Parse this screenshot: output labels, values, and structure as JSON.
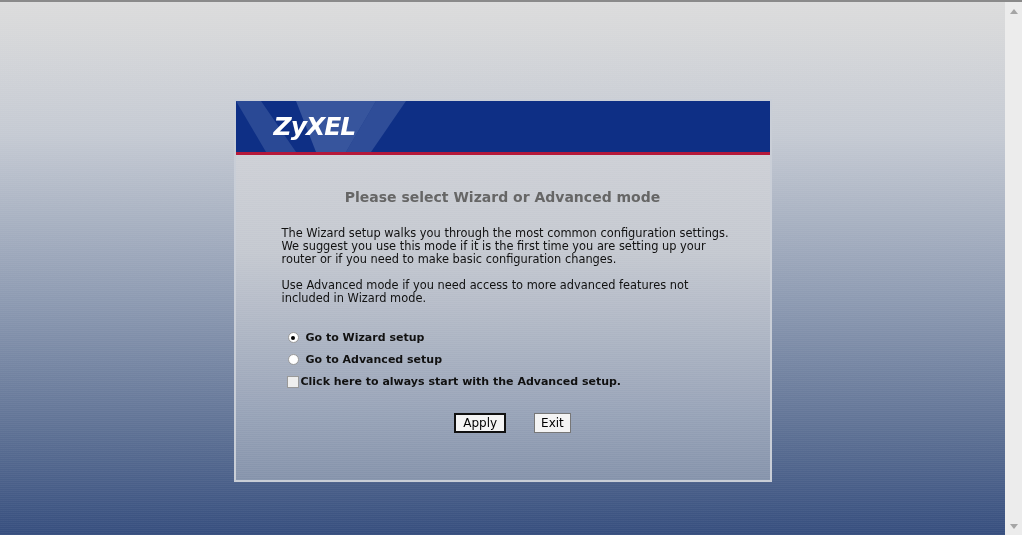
{
  "logo": {
    "text": "ZyXEL"
  },
  "title": "Please select Wizard or Advanced mode",
  "paragraphs": [
    "The Wizard setup walks you through the most common configuration settings. We suggest you use this mode if it is the first time you are setting up your router or if you need to make basic configuration changes.",
    "Use Advanced mode if you need access to more advanced features not included in Wizard mode."
  ],
  "modes": [
    {
      "label": "Go to Wizard setup",
      "selected": true
    },
    {
      "label": "Go to Advanced setup",
      "selected": false
    }
  ],
  "always_advanced": {
    "label": "Click here to always start with the Advanced setup.",
    "checked": false
  },
  "buttons": [
    {
      "label": "Apply",
      "default": true
    },
    {
      "label": "Exit",
      "default": false
    }
  ]
}
